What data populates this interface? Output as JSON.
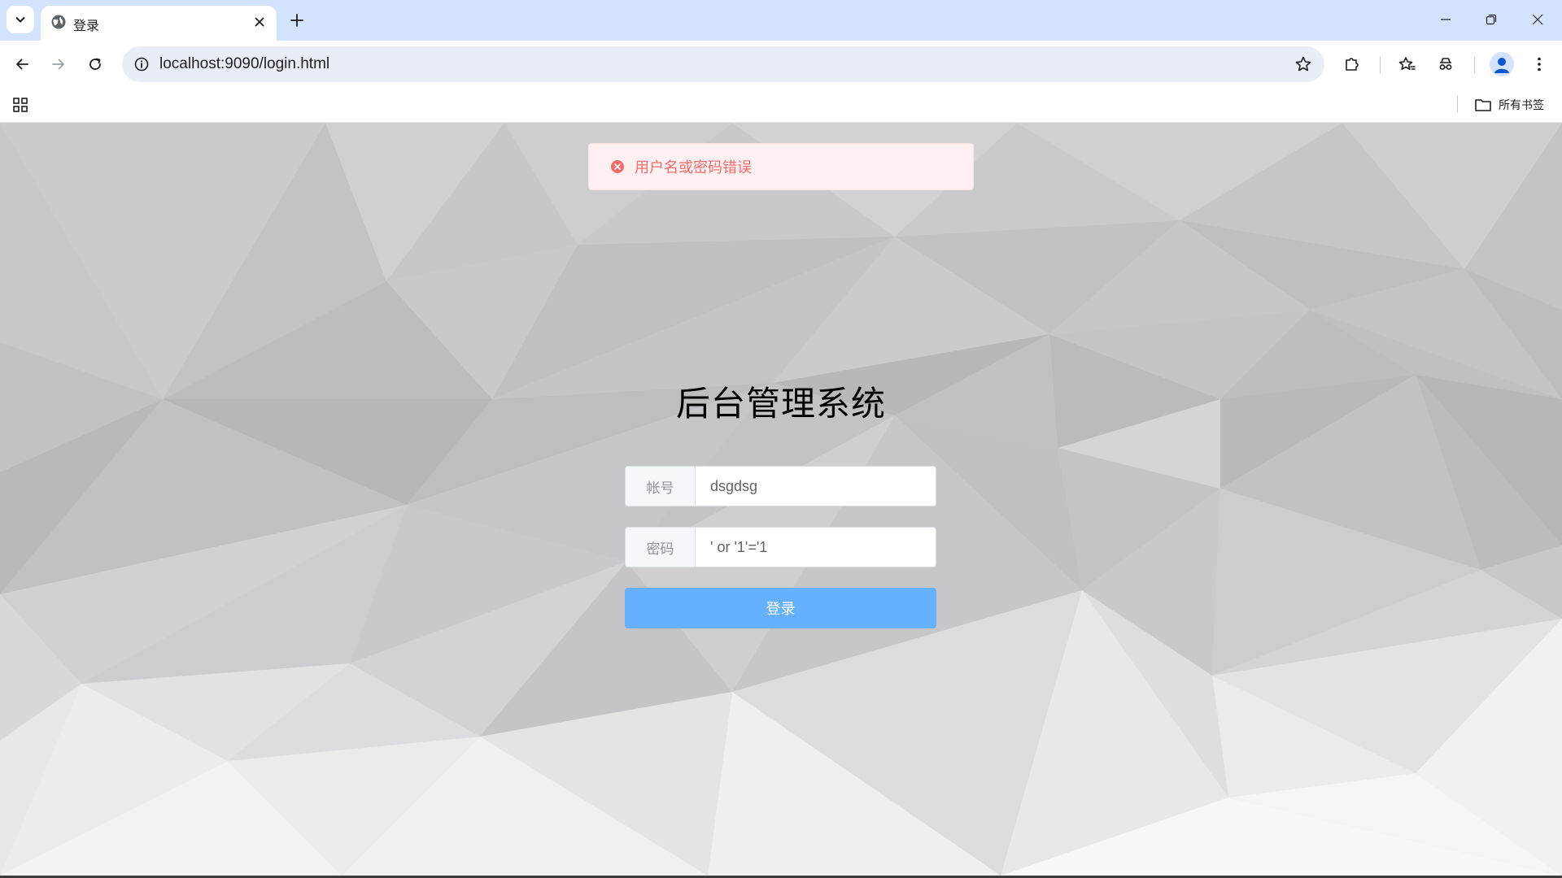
{
  "browser": {
    "tab_title": "登录",
    "url": "localhost:9090/login.html",
    "bookmarks_label": "所有书签"
  },
  "alert": {
    "type": "error",
    "message": "用户名或密码错误"
  },
  "login": {
    "title": "后台管理系统",
    "username_label": "帐号",
    "username_value": "dsgdsg",
    "password_label": "密码",
    "password_value": "' or '1'='1",
    "submit_label": "登录"
  },
  "colors": {
    "tabstrip": "#d3e3fd",
    "omnibox": "#e9eef6",
    "alert_bg": "#fef0f0",
    "alert_text": "#f56c6c",
    "button": "#66b1ff"
  },
  "icons": {
    "tab_search": "chevron-down-icon",
    "favicon": "globe-icon",
    "tab_close": "close-icon",
    "new_tab": "plus-icon",
    "back": "arrow-left-icon",
    "forward": "arrow-right-icon",
    "reload": "reload-icon",
    "site_info": "info-icon",
    "bookmark": "star-icon",
    "extensions": "puzzle-icon",
    "apps": "apps-grid-icon",
    "folder": "folder-icon",
    "alert": "circle-x-icon"
  }
}
